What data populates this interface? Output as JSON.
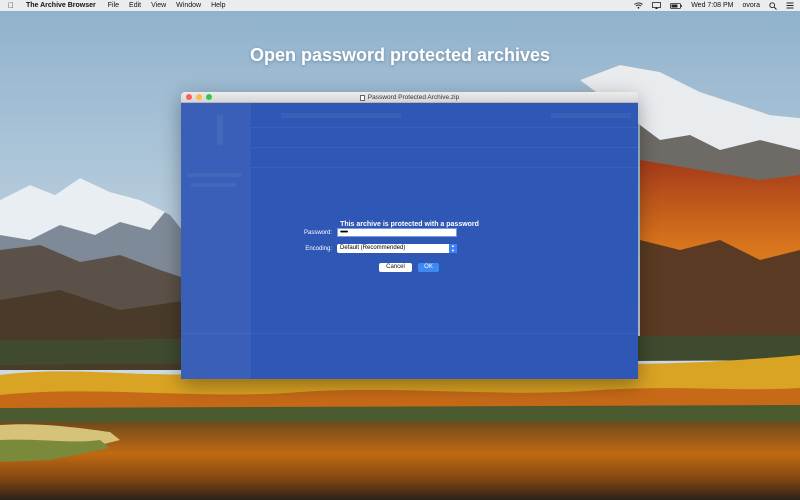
{
  "menubar": {
    "app_name": "The Archive Browser",
    "menus": [
      "File",
      "Edit",
      "View",
      "Window",
      "Help"
    ],
    "clock": "Wed 7:08 PM",
    "user": "ovora"
  },
  "headline": "Open password protected archives",
  "window": {
    "title": "Password Protected Archive.zip"
  },
  "dialog": {
    "title": "This archive is protected with a password",
    "password_label": "Password:",
    "password_value": "•••••",
    "encoding_label": "Encoding:",
    "encoding_value": "Default (Recommended)",
    "cancel_label": "Cancel",
    "ok_label": "OK"
  },
  "colors": {
    "window_overlay": "#2f57b5",
    "accent": "#3d8bf2"
  }
}
